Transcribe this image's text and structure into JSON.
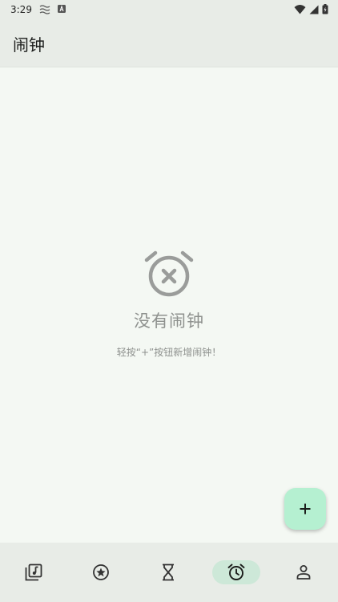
{
  "status_bar": {
    "time": "3:29",
    "icons": [
      "notification-icon",
      "keyboard-icon",
      "wifi-icon",
      "signal-icon",
      "battery-icon"
    ]
  },
  "app_bar": {
    "title": "闹钟"
  },
  "empty_state": {
    "icon": "alarm-off-icon",
    "title": "没有闹钟",
    "hint": "轻按“+”按钮新增闹钟！"
  },
  "fab": {
    "label": "+",
    "color": "#b5f0d1"
  },
  "bottom_nav": {
    "items": [
      {
        "icon": "music-library-icon",
        "active": false
      },
      {
        "icon": "star-icon",
        "active": false
      },
      {
        "icon": "hourglass-icon",
        "active": false
      },
      {
        "icon": "alarm-clock-icon",
        "active": true
      },
      {
        "icon": "person-icon",
        "active": false
      }
    ],
    "active_color": "#cde8d8"
  }
}
